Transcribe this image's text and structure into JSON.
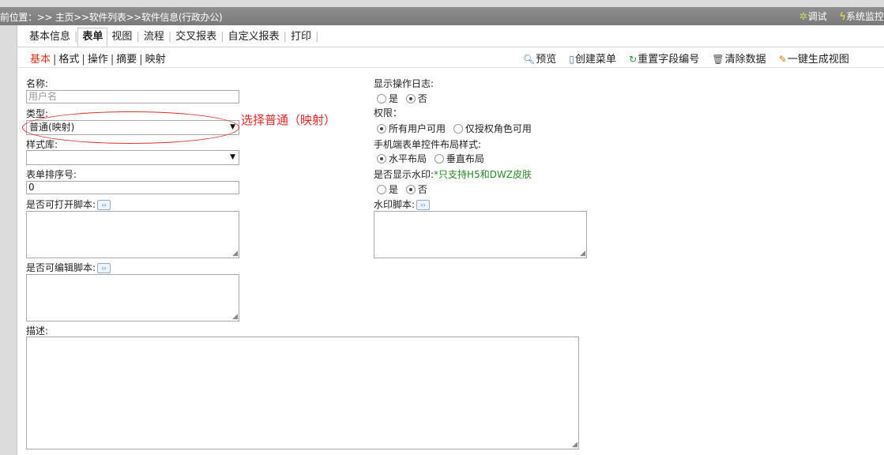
{
  "header": {
    "breadcrumb": "前位置：>> 主页>>软件列表>>软件信息(行政办公)",
    "debug_label": "调试",
    "monitor_label": "系统监控"
  },
  "tabs": [
    {
      "label": "基本信息",
      "active": false
    },
    {
      "label": "表单",
      "active": true
    },
    {
      "label": "视图",
      "active": false
    },
    {
      "label": "流程",
      "active": false
    },
    {
      "label": "交叉报表",
      "active": false
    },
    {
      "label": "自定义报表",
      "active": false
    },
    {
      "label": "打印",
      "active": false
    }
  ],
  "subnav": [
    {
      "label": "基本",
      "active": true
    },
    {
      "label": "格式",
      "active": false
    },
    {
      "label": "操作",
      "active": false
    },
    {
      "label": "摘要",
      "active": false
    },
    {
      "label": "映射",
      "active": false
    }
  ],
  "toolbar": {
    "preview": "预览",
    "create_menu": "创建菜单",
    "reset_field_numbers": "重置字段编号",
    "clear_data": "清除数据",
    "generate_view": "一键生成视图"
  },
  "form_left": {
    "name_label": "名称:",
    "name_placeholder": "用户名",
    "type_label": "类型:",
    "type_value": "普通(映射)",
    "style_lib_label": "样式库:",
    "style_lib_value": "",
    "sort_label": "表单排序号:",
    "sort_value": "0",
    "open_script_label": "是否可打开脚本:",
    "edit_script_label": "是否可编辑脚本:",
    "desc_label": "描述:"
  },
  "form_right": {
    "op_log_label": "显示操作日志:",
    "op_log_yes": "是",
    "op_log_no": "否",
    "perm_label": "权限：",
    "perm_all": "所有用户可用",
    "perm_auth": "仅授权角色可用",
    "mobile_layout_label": "手机端表单控件布局样式:",
    "mobile_horizontal": "水平布局",
    "mobile_vertical": "垂直布局",
    "watermark_label": "是否显示水印:",
    "watermark_note": "*只支持H5和DWZ皮肤",
    "watermark_yes": "是",
    "watermark_no": "否",
    "watermark_script_label": "水印脚本:"
  },
  "annotation": {
    "text": "选择普通（映射）",
    "color": "#e22a2a"
  },
  "icons": {
    "debug": "bug-icon",
    "monitor": "lightning-icon",
    "preview": "magnifier-icon",
    "create_menu": "document-icon",
    "reset": "refresh-icon",
    "clear": "trash-icon",
    "generate": "pencil-icon",
    "script": "code-icon"
  }
}
